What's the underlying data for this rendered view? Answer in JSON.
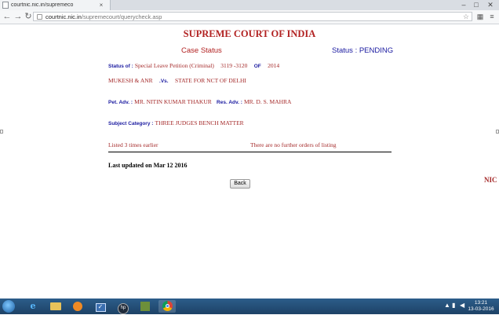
{
  "browser": {
    "tab_title": "courtnic.nic.in/supremeco",
    "url_domain": "courtnic.nic.in",
    "url_path": "/supremecourt/querycheck.asp",
    "window_minimize": "–",
    "window_maximize": "□",
    "window_close": "✕",
    "tab_close": "×"
  },
  "page": {
    "heading": "SUPREME COURT OF INDIA",
    "case_status_label": "Case Status",
    "status_text": "Status : PENDING",
    "status_of_label": "Status of :",
    "case_type": "Special Leave Petition (Criminal)",
    "case_number": "3119 -3120",
    "of_label": "OF",
    "case_year": "2014",
    "petitioner": "MUKESH & ANR",
    "vs_label": ".Vs.",
    "respondent": "STATE FOR NCT OF DELHI",
    "pet_adv_label": "Pet. Adv. :",
    "pet_adv": "MR. NITIN KUMAR THAKUR",
    "res_adv_label": "Res. Adv. :",
    "res_adv": "MR. D. S. MAHRA",
    "subject_category_label": "Subject Category :",
    "subject_category": "THREE JUDGES BENCH MATTER",
    "listed_text": "Listed 3 times earlier",
    "further_orders_text": "There are no further orders of listing",
    "last_updated": "Last updated on Mar 12 2016",
    "back_button": "Back",
    "nic_label": "NIC"
  },
  "taskbar": {
    "time": "13:21",
    "date": "13-03-2016",
    "apps": [
      "ie-icon",
      "file-explorer-icon",
      "media-player-icon",
      "checklist-icon",
      "hp-icon",
      "books-icon",
      "chrome-icon"
    ]
  }
}
